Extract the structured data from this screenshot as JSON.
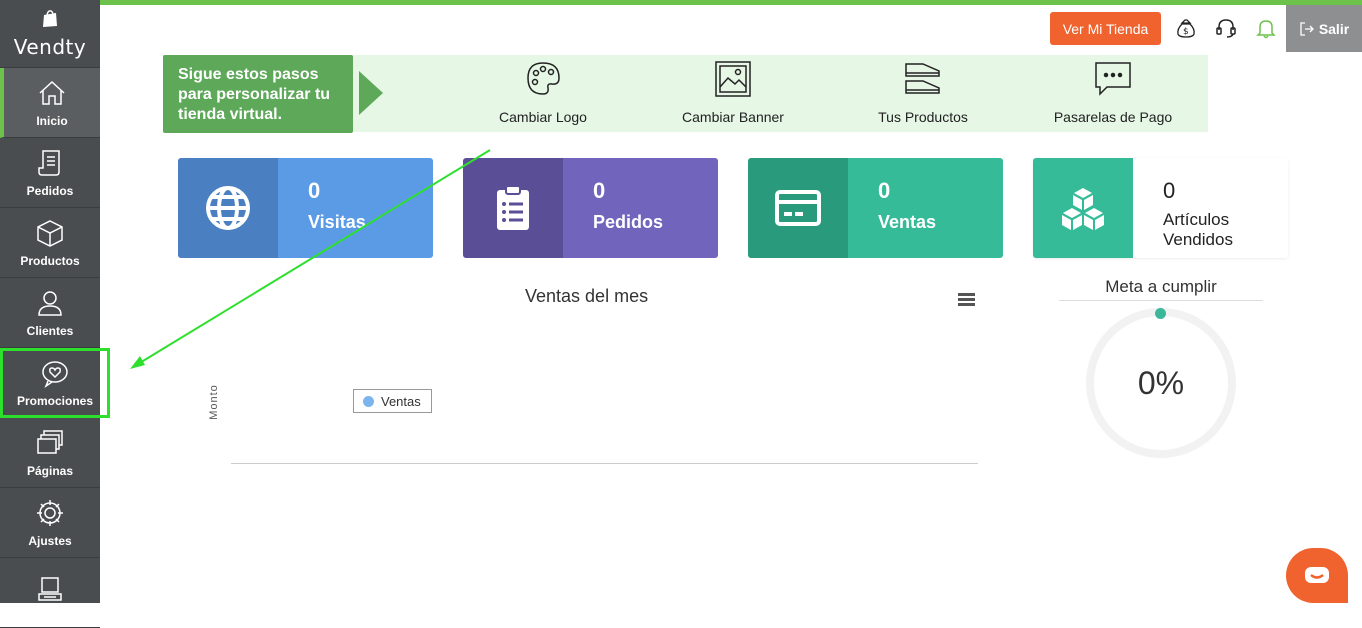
{
  "app": {
    "brand": "Vendty"
  },
  "sidebar": {
    "items": [
      {
        "label": "Inicio",
        "icon": "home-icon"
      },
      {
        "label": "Pedidos",
        "icon": "receipt-icon"
      },
      {
        "label": "Productos",
        "icon": "box-icon"
      },
      {
        "label": "Clientes",
        "icon": "user-icon"
      },
      {
        "label": "Promociones",
        "icon": "heart-chat-icon"
      },
      {
        "label": "Páginas",
        "icon": "pages-icon"
      },
      {
        "label": "Ajustes",
        "icon": "gear-icon"
      },
      {
        "label": "",
        "icon": "computer-icon"
      }
    ]
  },
  "header": {
    "store_button": "Ver Mi Tienda",
    "logout": "Salir"
  },
  "steps": {
    "title": "Sigue estos pasos para personalizar tu tienda virtual.",
    "items": [
      {
        "label": "Cambiar Logo",
        "icon": "palette-icon"
      },
      {
        "label": "Cambiar Banner",
        "icon": "image-icon"
      },
      {
        "label": "Tus Productos",
        "icon": "shoes-icon"
      },
      {
        "label": "Pasarelas de Pago",
        "icon": "chat-bubble-icon"
      }
    ]
  },
  "cards": [
    {
      "value": "0",
      "label": "Visitas",
      "color_dark": "#4a7fc1",
      "color_light": "#5b9be6"
    },
    {
      "value": "0",
      "label": "Pedidos",
      "color_dark": "#5a4e96",
      "color_light": "#7064bc"
    },
    {
      "value": "0",
      "label": "Ventas",
      "color_dark": "#2a9a7c",
      "color_light": "#36bb99"
    },
    {
      "value": "0",
      "label": "Artículos Vendidos",
      "color_dark": "#36bb99",
      "color_light": "#ffffff"
    }
  ],
  "chart": {
    "title": "Ventas del mes",
    "ylabel": "Monto",
    "legend": "Ventas"
  },
  "chart_data": {
    "type": "line",
    "title": "Ventas del mes",
    "ylabel": "Monto",
    "series": [
      {
        "name": "Ventas",
        "values": []
      }
    ]
  },
  "meta": {
    "title": "Meta a cumplir",
    "value": "0%"
  },
  "colors": {
    "accent": "#6cc24a",
    "orange": "#f0622e",
    "sidebar": "#4a4d4f"
  }
}
